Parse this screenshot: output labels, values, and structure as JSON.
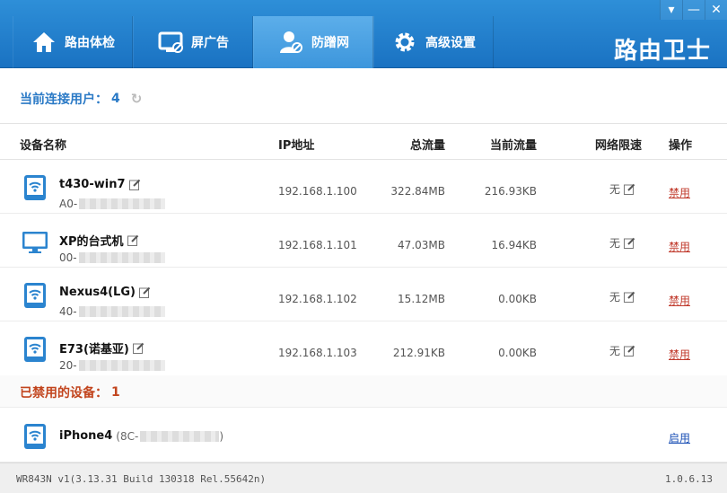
{
  "window": {
    "brand": "路由卫士",
    "min_label": "—",
    "close_label": "✕",
    "menu_label": "▾"
  },
  "tabs": [
    {
      "label": "路由体检",
      "icon": "home-icon"
    },
    {
      "label": "屏广告",
      "icon": "monitor-block-icon"
    },
    {
      "label": "防蹭网",
      "icon": "user-shield-icon",
      "active": true
    },
    {
      "label": "高级设置",
      "icon": "gear-icon"
    }
  ],
  "connected": {
    "label": "当前连接用户：",
    "count": "4"
  },
  "columns": {
    "device": "设备名称",
    "ip": "IP地址",
    "total": "总流量",
    "current": "当前流量",
    "limit": "网络限速",
    "action": "操作"
  },
  "devices": [
    {
      "name": "t430-win7",
      "mac": "A0-",
      "ip": "192.168.1.100",
      "total": "322.84MB",
      "current": "216.93KB",
      "limit": "无",
      "action": "禁用",
      "type": "tablet"
    },
    {
      "name": "XP的台式机",
      "mac": "00-",
      "ip": "192.168.1.101",
      "total": "47.03MB",
      "current": "16.94KB",
      "limit": "无",
      "action": "禁用",
      "type": "desktop"
    },
    {
      "name": "Nexus4(LG)",
      "mac": "40-",
      "ip": "192.168.1.102",
      "total": "15.12MB",
      "current": "0.00KB",
      "limit": "无",
      "action": "禁用",
      "type": "tablet"
    },
    {
      "name": "E73(诺基亚)",
      "mac": "20-",
      "ip": "192.168.1.103",
      "total": "212.91KB",
      "current": "0.00KB",
      "limit": "无",
      "action": "禁用",
      "type": "tablet"
    }
  ],
  "blocked": {
    "label": "已禁用的设备：",
    "count": "1",
    "device": {
      "name": "iPhone4",
      "mac_prefix": "(8C-",
      "mac_suffix": ")",
      "action": "启用"
    }
  },
  "status": {
    "left": "WR843N v1(3.13.31 Build 130318 Rel.55642n)",
    "right": "1.0.6.13"
  },
  "colors": {
    "accent": "#1a72c2",
    "disable": "#c0392b",
    "enable": "#1a4fb5",
    "blocked_title": "#c2451e"
  }
}
